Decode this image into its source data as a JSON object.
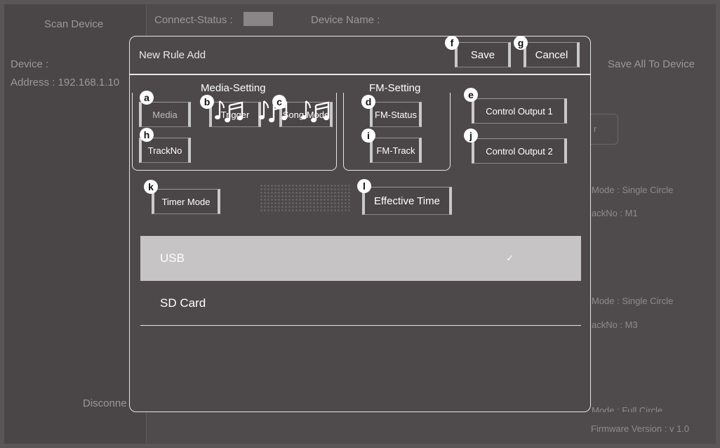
{
  "background": {
    "scan_device": "Scan Device",
    "device_label": "Device :",
    "address_label": "Address : 192.168.1.10",
    "disconnect": "Disconne",
    "connect_status": "Connect-Status :",
    "device_name": "Device Name :",
    "save_all": "Save All To Device",
    "field_fragment": "r",
    "mode1": "Mode : Single Circle",
    "track1": "ackNo : M1",
    "mode2": "Mode : Single Circle",
    "track2": "ackNo : M3",
    "mode3": "Mode : Full Circle",
    "firmware": "Firmware Version : v 1.0"
  },
  "modal": {
    "title": "New Rule Add",
    "save": "Save",
    "cancel": "Cancel",
    "media_setting": "Media-Setting",
    "fm_setting": "FM-Setting",
    "buttons": {
      "media": "Media",
      "trigger": "Trigger",
      "song_mode": "Song Mode",
      "trackno": "TrackNo",
      "fm_status": "FM-Status",
      "fm_track": "FM-Track",
      "control_output_1": "Control Output 1",
      "control_output_2": "Control Output 2",
      "timer_mode": "Timer Mode",
      "effective_time": "Effective Time"
    },
    "markers": {
      "a": "a",
      "b": "b",
      "c": "c",
      "d": "d",
      "e": "e",
      "f": "f",
      "g": "g",
      "h": "h",
      "i": "i",
      "j": "j",
      "k": "k",
      "l": "l"
    },
    "media_options": [
      {
        "label": "USB",
        "check": "✓"
      },
      {
        "label": "SD Card"
      }
    ]
  },
  "icons": {
    "music": "music-note-icon",
    "check": "check-icon"
  },
  "colors": {
    "background": "#4f4a4b",
    "selected_row": "#c6c4c5",
    "border": "#e6e6e6"
  }
}
